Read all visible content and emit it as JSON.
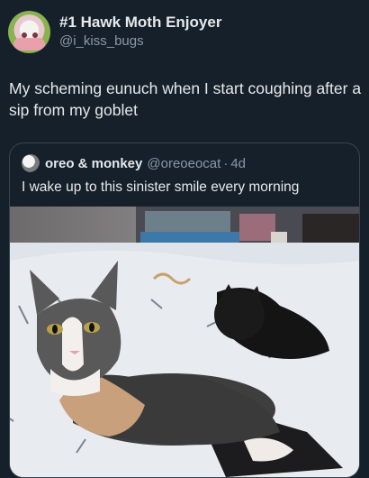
{
  "post": {
    "display_name": "#1 Hawk Moth Enjoyer",
    "handle": "@i_kiss_bugs",
    "text": "My scheming eunuch when I start coughing after a sip from my goblet",
    "avatar_icon": "avatar-image"
  },
  "quote": {
    "display_name": "oreo & monkey",
    "handle": "@oreoeocat",
    "separator": "·",
    "time": "4d",
    "text": "I wake up to this sinister smile every morning",
    "image_icon": "cat-photo"
  },
  "colors": {
    "background": "#15202b",
    "primary_text": "#e7e9ea",
    "secondary_text": "#8b98a5",
    "border": "#38444d"
  }
}
